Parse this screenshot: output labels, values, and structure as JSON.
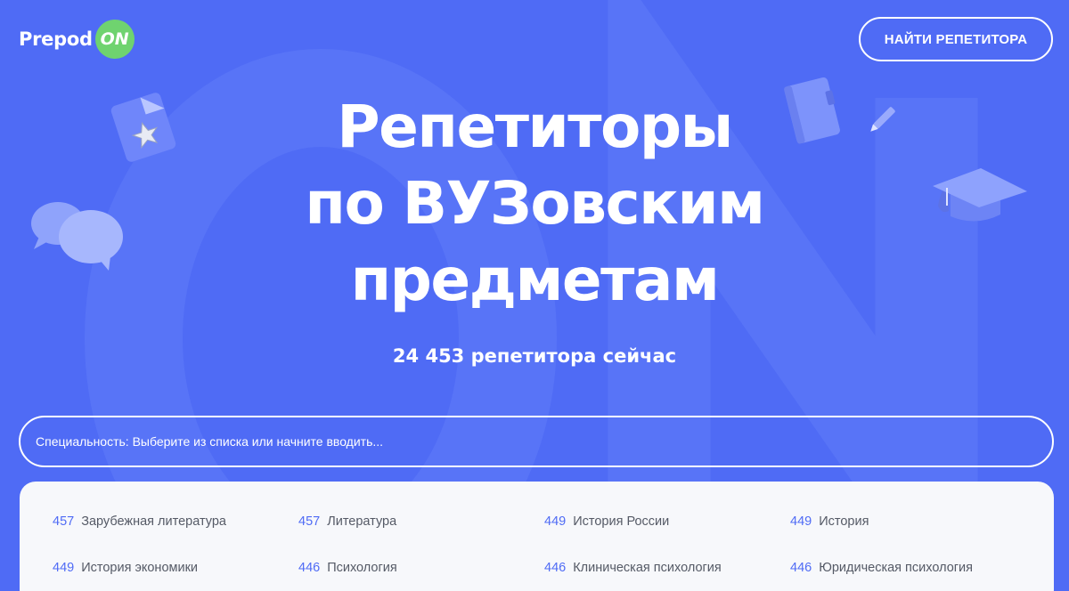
{
  "logo": {
    "text": "Prepod",
    "badge": "ON"
  },
  "header": {
    "find_button": "НАЙТИ РЕПЕТИТОРА"
  },
  "hero": {
    "title_lines": [
      "Репетиторы",
      "по ВУЗовским",
      "предметам"
    ],
    "counter": "24 453 репетитора сейчас"
  },
  "search": {
    "label": "Специальность: ",
    "placeholder": "Выберите из списка или начните вводить..."
  },
  "subjects": [
    {
      "count": "457",
      "name": "Зарубежная литература"
    },
    {
      "count": "457",
      "name": "Литература"
    },
    {
      "count": "449",
      "name": "История России"
    },
    {
      "count": "449",
      "name": "История"
    },
    {
      "count": "449",
      "name": "История экономики"
    },
    {
      "count": "446",
      "name": "Психология"
    },
    {
      "count": "446",
      "name": "Клиническая психология"
    },
    {
      "count": "446",
      "name": "Юридическая психология"
    }
  ],
  "colors": {
    "background": "#4f6bf5",
    "accent": "#6fd36f",
    "panel": "#f7f8fb",
    "count_text": "#4f6bf5",
    "name_text": "#555a66"
  },
  "icons": [
    "document-star-icon",
    "speech-bubbles-icon",
    "notebook-icon",
    "pencil-icon",
    "graduation-cap-icon"
  ]
}
